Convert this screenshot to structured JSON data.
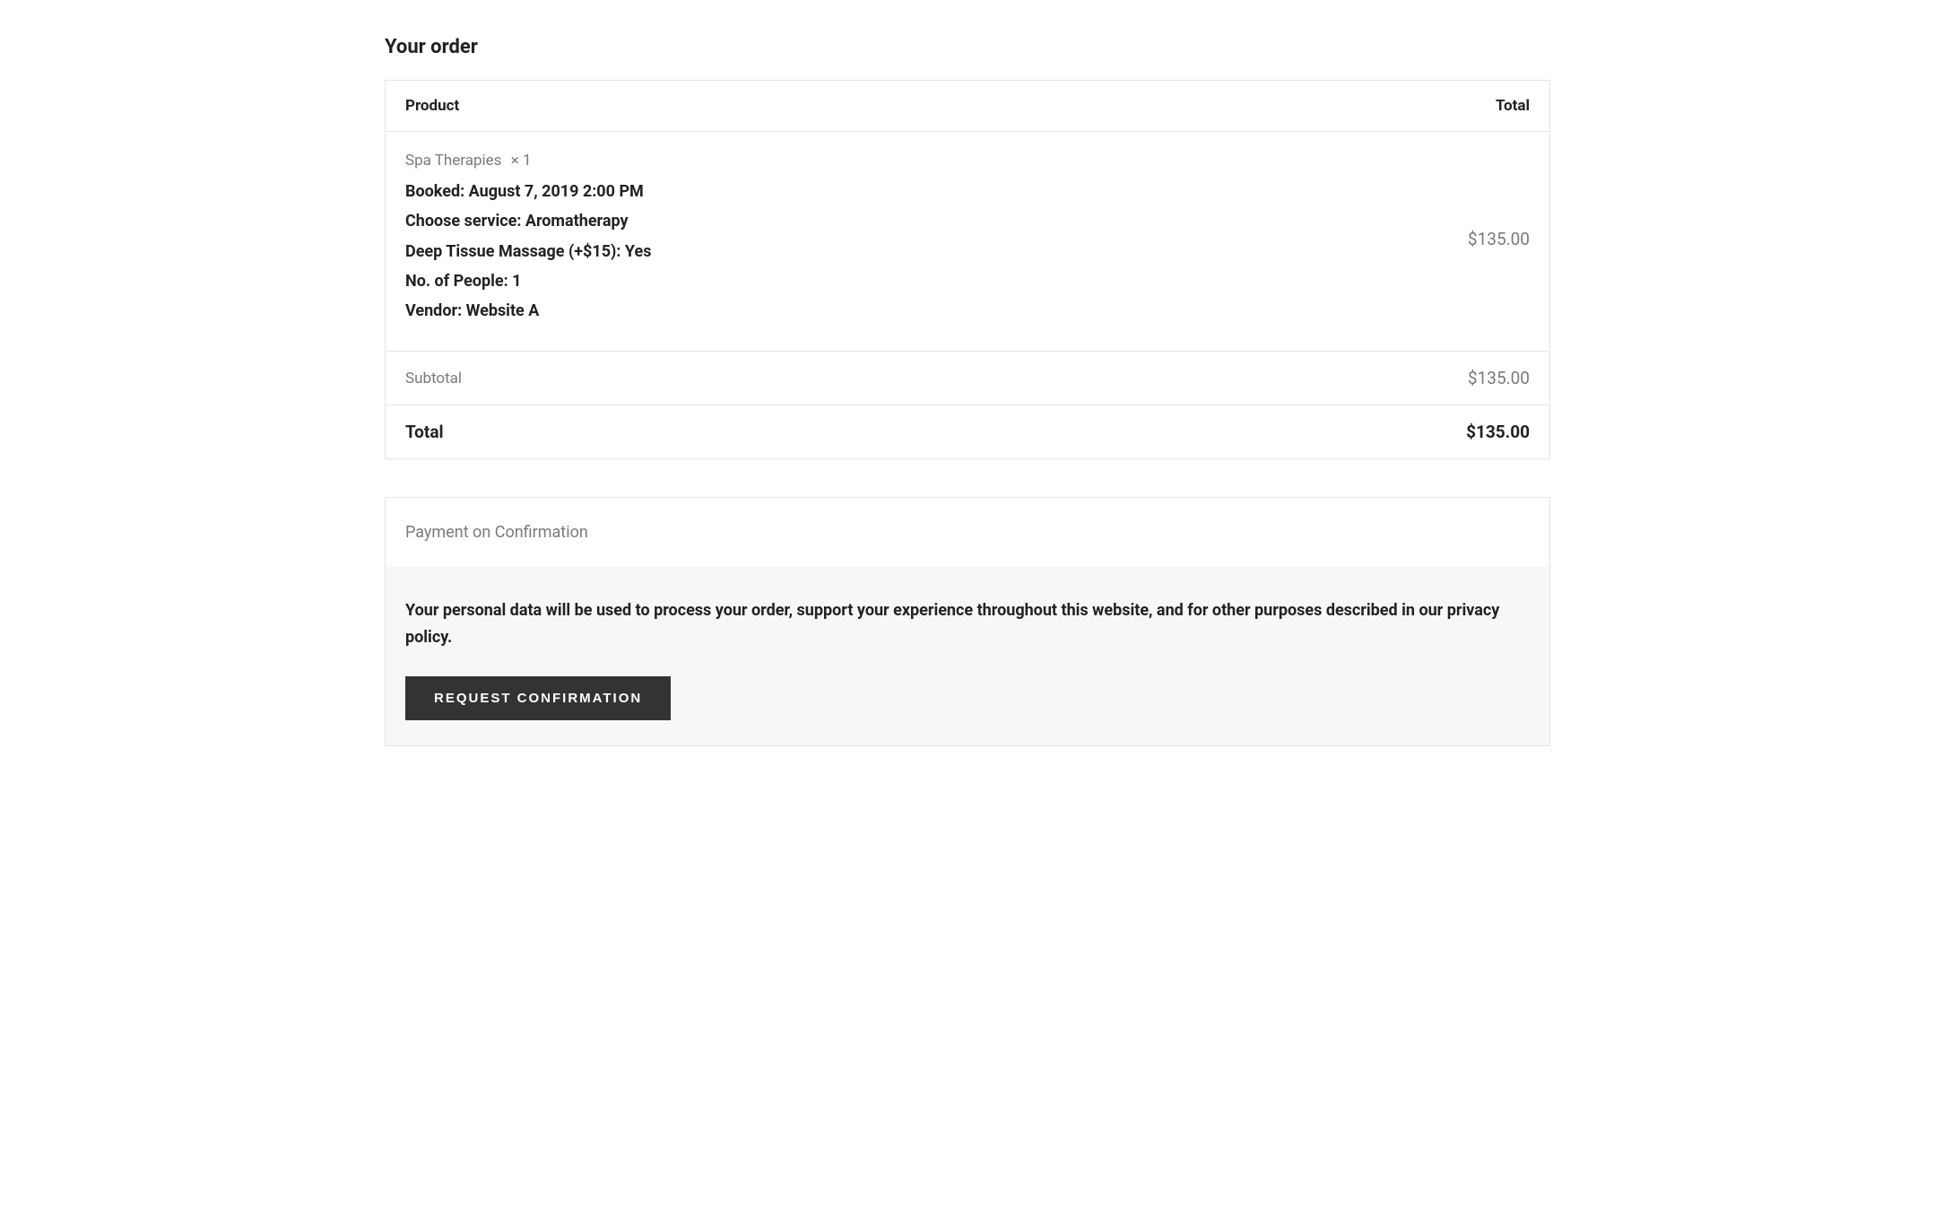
{
  "heading": "Your order",
  "table": {
    "header_product": "Product",
    "header_total": "Total",
    "item": {
      "name": "Spa Therapies",
      "qty": "× 1",
      "booked": "Booked: August 7, 2019 2:00 PM",
      "service": "Choose service: Aromatherapy",
      "addon": "Deep Tissue Massage (+$15): Yes",
      "people": "No. of People: 1",
      "vendor": "Vendor: Website A",
      "price": "$135.00"
    },
    "subtotal_label": "Subtotal",
    "subtotal_value": "$135.00",
    "total_label": "Total",
    "total_value": "$135.00"
  },
  "payment": {
    "method": "Payment on Confirmation",
    "privacy_text": "Your personal data will be used to process your order, support your experience throughout this website, and for other purposes described in our ",
    "privacy_link": "privacy policy",
    "privacy_suffix": ".",
    "button": "Request Confirmation"
  }
}
